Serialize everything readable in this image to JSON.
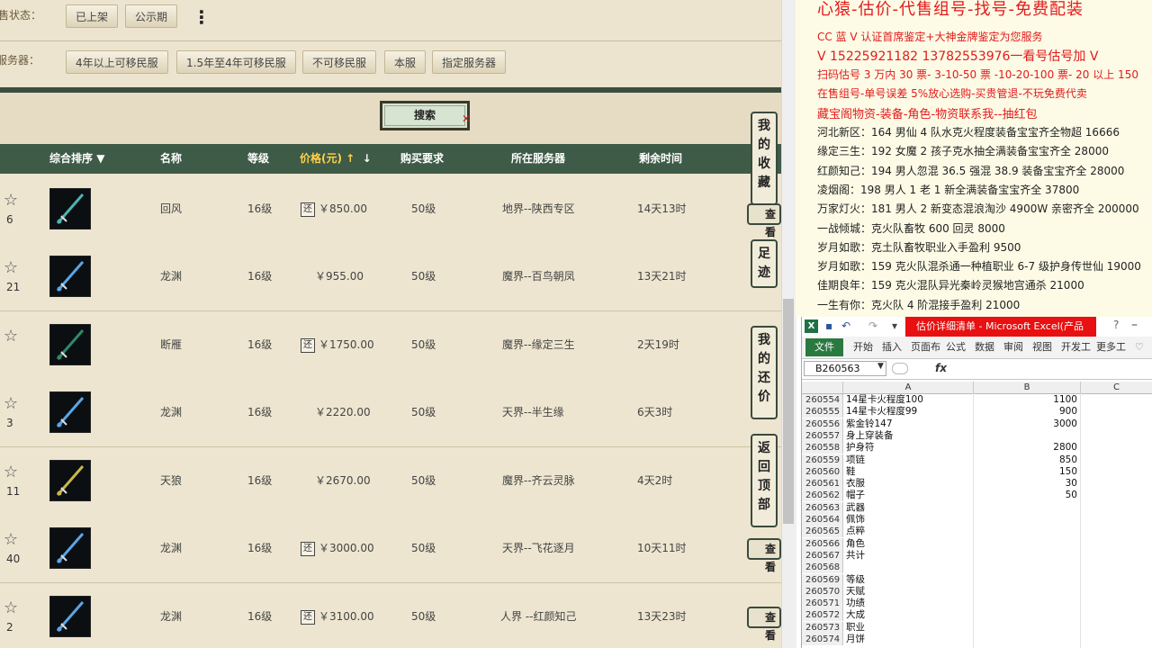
{
  "filters": {
    "sale_status_label": "出售状态：",
    "sale_status_options": [
      "已上架",
      "公示期"
    ],
    "server_label": "服务器：",
    "server_options": [
      "4年以上可移民服",
      "1.5年至4年可移民服",
      "不可移民服",
      "本服",
      "指定服务器"
    ],
    "search_label": "搜索"
  },
  "table": {
    "columns": {
      "sort": "综合排序",
      "name": "名称",
      "level": "等级",
      "price": "价格(元)",
      "requirement": "购买要求",
      "server": "所在服务器",
      "time_left": "剩余时间"
    },
    "rows": [
      {
        "count": "6",
        "name": "回风",
        "level": "16级",
        "bargain": true,
        "price": "￥850.00",
        "req": "50级",
        "server": "地界--陕西专区",
        "time": "14天13时",
        "icon": "whip-icon",
        "color": "#4fb3b0"
      },
      {
        "count": "21",
        "name": "龙渊",
        "level": "16级",
        "bargain": false,
        "price": "￥955.00",
        "req": "50级",
        "server": "魔界--百鸟朝凤",
        "time": "13天21时",
        "icon": "sword-icon",
        "color": "#5aa6e6"
      },
      {
        "count": "",
        "name": "断雁",
        "level": "16级",
        "bargain": true,
        "price": "￥1750.00",
        "req": "50级",
        "server": "魔界--缘定三生",
        "time": "2天19时",
        "icon": "blade-icon",
        "color": "#2e8a6a"
      },
      {
        "count": "3",
        "name": "龙渊",
        "level": "16级",
        "bargain": false,
        "price": "￥2220.00",
        "req": "50级",
        "server": "天界--半生缘",
        "time": "6天3时",
        "icon": "sword-icon",
        "color": "#5aa6e6"
      },
      {
        "count": "11",
        "name": "天狼",
        "level": "16级",
        "bargain": false,
        "price": "￥2670.00",
        "req": "50级",
        "server": "魔界--齐云灵脉",
        "time": "4天2时",
        "icon": "spear-icon",
        "color": "#c8b84a"
      },
      {
        "count": "40",
        "name": "龙渊",
        "level": "16级",
        "bargain": true,
        "price": "￥3000.00",
        "req": "50级",
        "server": "天界--飞花逐月",
        "time": "10天11时",
        "icon": "sword-icon",
        "color": "#5aa6e6"
      },
      {
        "count": "2",
        "name": "龙渊",
        "level": "16级",
        "bargain": true,
        "price": "￥3100.00",
        "req": "50级",
        "server": "人界 --红颜知己",
        "time": "13天23时",
        "icon": "sword-icon",
        "color": "#5aa6e6"
      }
    ]
  },
  "side_tabs": [
    "我的收藏",
    "足迹",
    "我的还价",
    "返回顶部"
  ],
  "check_label": "查看",
  "notice": {
    "title": "心猿-估价-代售组号-找号-免费配装",
    "lines": [
      "CC 蓝 V 认证首席鉴定+大神金牌鉴定为您服务",
      "V 15225921182      13782553976一看号估号加 V",
      "扫码估号 3 万内 30 票- 3-10-50 票  -10-20-100 票- 20 以上 150",
      "在售组号-单号误差 5%放心选购-买贵管退-不玩免费代卖",
      "藏宝阁物资-装备-角色-物资联系我--抽红包"
    ],
    "listings": [
      "河北新区：164 男仙 4 队水克火程度装备宝宝齐全物超 16666",
      "缘定三生：192 女魔 2 孩子克水抽全满装备宝宝齐全 28000",
      "红颜知己：194 男人忽混 36.5 强混 38.9 装备宝宝齐全 28000",
      "凌烟阁：198 男人 1 老 1 新全满装备宝宝齐全 37800",
      "万家灯火：181 男人 2 新变态混浪淘沙 4900W 亲密齐全 200000",
      "一战倾城：克火队畜牧 600 回灵 8000",
      "岁月如歌：克土队畜牧职业入手盈利 9500",
      "岁月如歌：159 克火队混杀通一种植职业 6-7 级护身传世仙 19000",
      "佳期良年：159 克火混队异光秦岭灵猴地宫通杀 21000",
      "一生有你：克火队 4 阶混接手盈利 21000"
    ]
  },
  "excel": {
    "title": "估价详细清单 - Microsoft Excel(产品",
    "file_tab": "文件",
    "tabs": [
      "开始",
      "插入",
      "页面布",
      "公式",
      "数据",
      "审阅",
      "视图",
      "开发工",
      "更多工"
    ],
    "name_box": "B260563",
    "fx": "fx",
    "col_headers": [
      "A",
      "B",
      "C"
    ],
    "rows": [
      {
        "n": "260554",
        "a": "14星卡火程度100",
        "b": "1100"
      },
      {
        "n": "260555",
        "a": "14星卡火程度99",
        "b": "900"
      },
      {
        "n": "260556",
        "a": "紫金铃147",
        "b": "3000"
      },
      {
        "n": "260557",
        "a": "身上穿装备",
        "b": ""
      },
      {
        "n": "260558",
        "a": "护身符",
        "b": "2800"
      },
      {
        "n": "260559",
        "a": "项链",
        "b": "850"
      },
      {
        "n": "260560",
        "a": "鞋",
        "b": "150"
      },
      {
        "n": "260561",
        "a": "衣服",
        "b": "30"
      },
      {
        "n": "260562",
        "a": "帽子",
        "b": "50"
      },
      {
        "n": "260563",
        "a": "武器",
        "b": ""
      },
      {
        "n": "260564",
        "a": "佩饰",
        "b": ""
      },
      {
        "n": "260565",
        "a": "点粹",
        "b": ""
      },
      {
        "n": "260566",
        "a": "角色",
        "b": ""
      },
      {
        "n": "260567",
        "a": "共计",
        "b": ""
      },
      {
        "n": "260568",
        "a": "",
        "b": ""
      },
      {
        "n": "260569",
        "a": "等级",
        "b": ""
      },
      {
        "n": "260570",
        "a": "天赋",
        "b": ""
      },
      {
        "n": "260571",
        "a": "功绩",
        "b": ""
      },
      {
        "n": "260572",
        "a": "大成",
        "b": ""
      },
      {
        "n": "260573",
        "a": "职业",
        "b": ""
      },
      {
        "n": "260574",
        "a": "月饼",
        "b": ""
      }
    ]
  }
}
